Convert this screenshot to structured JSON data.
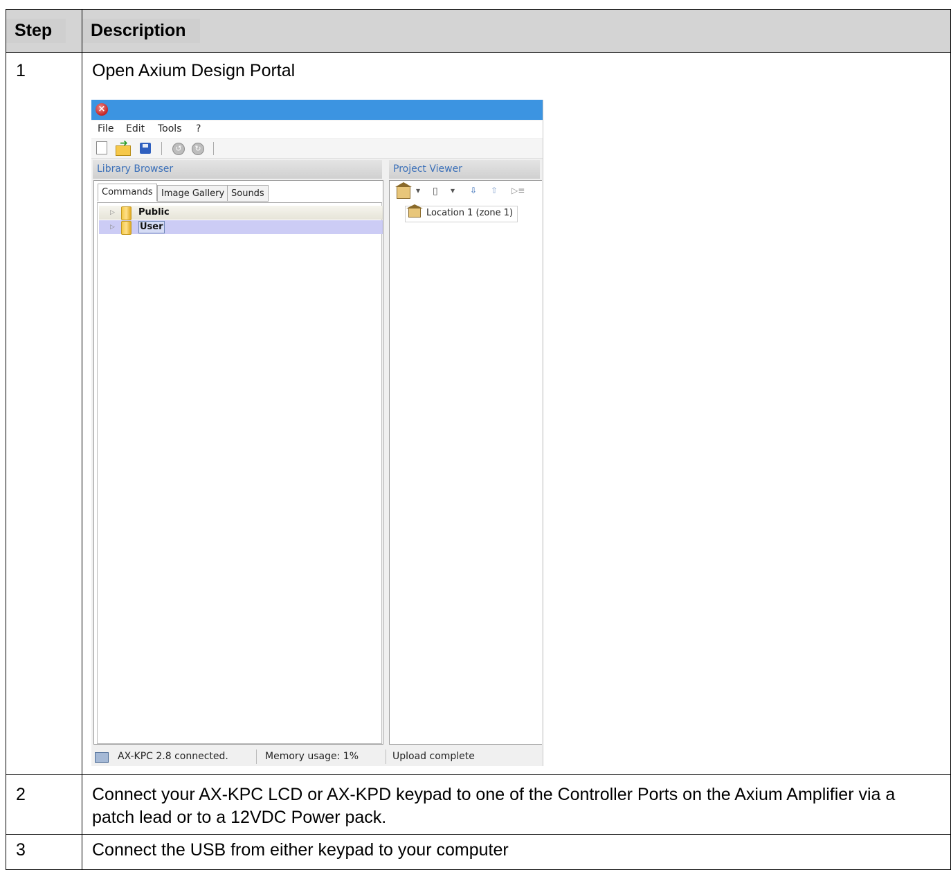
{
  "table": {
    "headers": {
      "step": "Step",
      "description": "Description"
    },
    "rows": [
      {
        "step": "1",
        "description": "Open Axium Design Portal"
      },
      {
        "step": "2",
        "description": "Connect your AX-KPC LCD or AX-KPD keypad to one of the Controller Ports on the Axium Amplifier via a patch lead or to a 12VDC Power pack."
      },
      {
        "step": "3",
        "description": "Connect the USB from either keypad to your computer"
      }
    ]
  },
  "app": {
    "menu": [
      "File",
      "Edit",
      "Tools",
      "?"
    ],
    "toolbar_icons": [
      "new-document-icon",
      "open-folder-icon",
      "save-icon",
      "undo-icon",
      "redo-icon"
    ],
    "library_browser": {
      "title": "Library Browser",
      "tabs": [
        "Commands",
        "Image Gallery",
        "Sounds"
      ],
      "active_tab": "Commands",
      "tree": [
        {
          "label": "Public",
          "selected": false
        },
        {
          "label": "User",
          "selected": true
        }
      ]
    },
    "project_viewer": {
      "title": "Project Viewer",
      "items": [
        {
          "label": "Location 1 (zone 1)"
        }
      ]
    },
    "status": {
      "connection": "AX-KPC 2.8 connected.",
      "memory": "Memory usage: 1%",
      "upload": "Upload complete"
    },
    "colors": {
      "titlebar": "#3c94e1",
      "header_bg": "#d4d4d4",
      "selection": "#ccccf5"
    }
  }
}
